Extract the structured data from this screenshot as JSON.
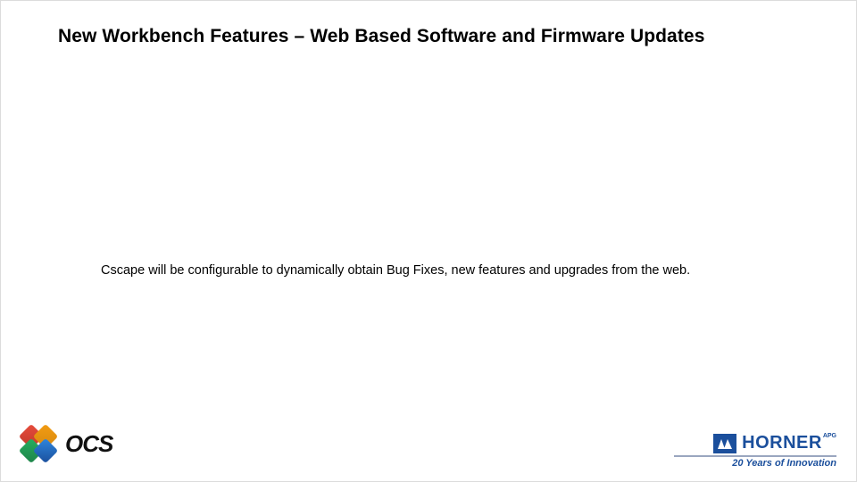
{
  "title": "New Workbench Features – Web Based Software and Firmware Updates",
  "body": "Cscape will be configurable to dynamically obtain Bug Fixes, new features and upgrades from the web.",
  "footer": {
    "left_logo": {
      "text": "OCS"
    },
    "right_logo": {
      "brand": "HORNER",
      "suffix": "APG",
      "tagline": "20 Years of Innovation"
    }
  }
}
